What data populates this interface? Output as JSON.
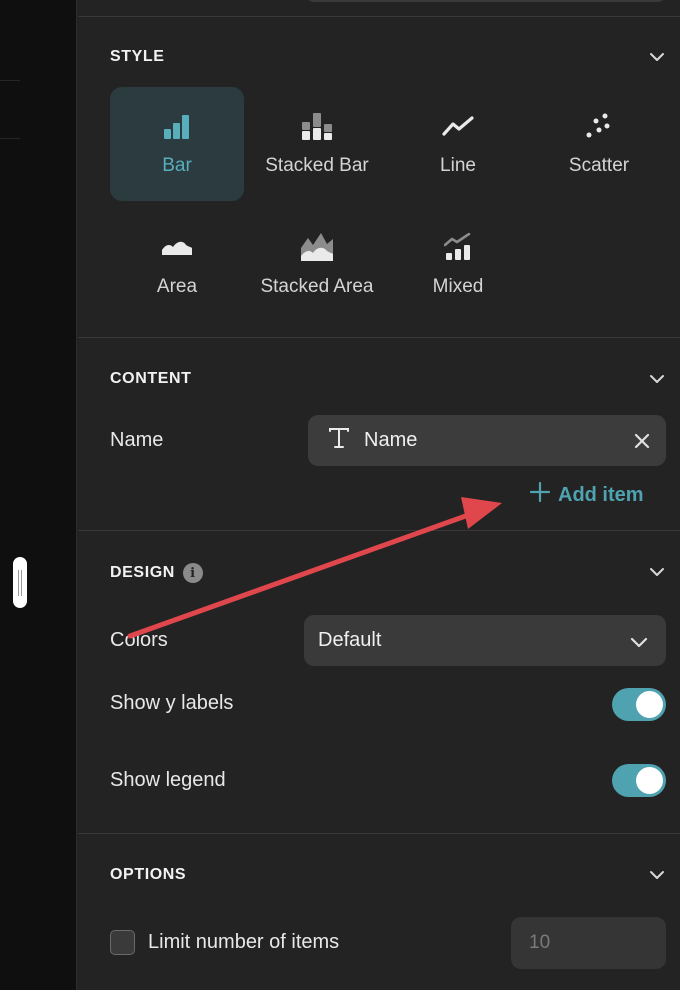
{
  "sections": {
    "style": {
      "title": "STYLE",
      "options": [
        {
          "label": "Bar",
          "icon": "bar-chart-icon",
          "active": true
        },
        {
          "label": "Stacked Bar",
          "icon": "stacked-bar-icon",
          "active": false
        },
        {
          "label": "Line",
          "icon": "line-chart-icon",
          "active": false
        },
        {
          "label": "Scatter",
          "icon": "scatter-chart-icon",
          "active": false
        },
        {
          "label": "Area",
          "icon": "area-chart-icon",
          "active": false
        },
        {
          "label": "Stacked Area",
          "icon": "stacked-area-icon",
          "active": false
        },
        {
          "label": "Mixed",
          "icon": "mixed-chart-icon",
          "active": false
        }
      ]
    },
    "content": {
      "title": "CONTENT",
      "name_label": "Name",
      "name_chip": {
        "text": "Name",
        "icon": "text-type-icon"
      },
      "add_item": "Add item"
    },
    "design": {
      "title": "DESIGN",
      "info_glyph": "i",
      "colors_label": "Colors",
      "colors_value": "Default",
      "show_y_labels": {
        "label": "Show y labels",
        "on": true
      },
      "show_legend": {
        "label": "Show legend",
        "on": true
      }
    },
    "options": {
      "title": "OPTIONS",
      "limit_label": "Limit number of items",
      "limit_checked": false,
      "limit_placeholder": "10"
    }
  },
  "colors": {
    "accent": "#4fa2b0",
    "active_tile_bg": "#2b3b40",
    "panel_bg": "#232323",
    "annotation_arrow": "#e0474c"
  }
}
